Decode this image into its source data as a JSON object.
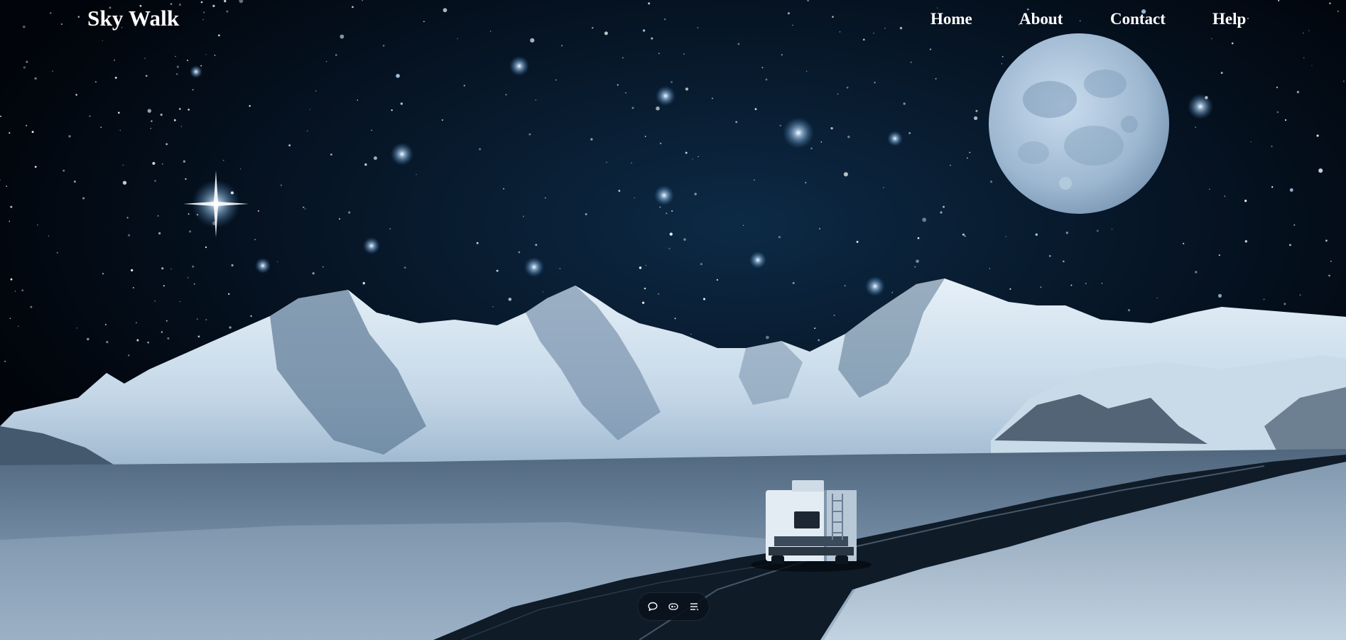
{
  "brand": {
    "title": "Sky Walk"
  },
  "nav": {
    "items": [
      {
        "label": "Home"
      },
      {
        "label": "About"
      },
      {
        "label": "Contact"
      },
      {
        "label": "Help"
      }
    ]
  },
  "hero": {
    "background_image": "night-sky-mountains-camper-van",
    "palette": {
      "sky": "#02050c",
      "sky_glow": "#0d2c48",
      "moon": "#a9c3dc",
      "snow": "#dbe8f3",
      "rock": "#3f5a74",
      "field": "#5c7690",
      "road": "#0e1924"
    }
  },
  "toolbar": {
    "buttons": [
      {
        "icon": "chat-bubble-icon"
      },
      {
        "icon": "caption-icon"
      },
      {
        "icon": "menu-list-icon"
      }
    ]
  }
}
